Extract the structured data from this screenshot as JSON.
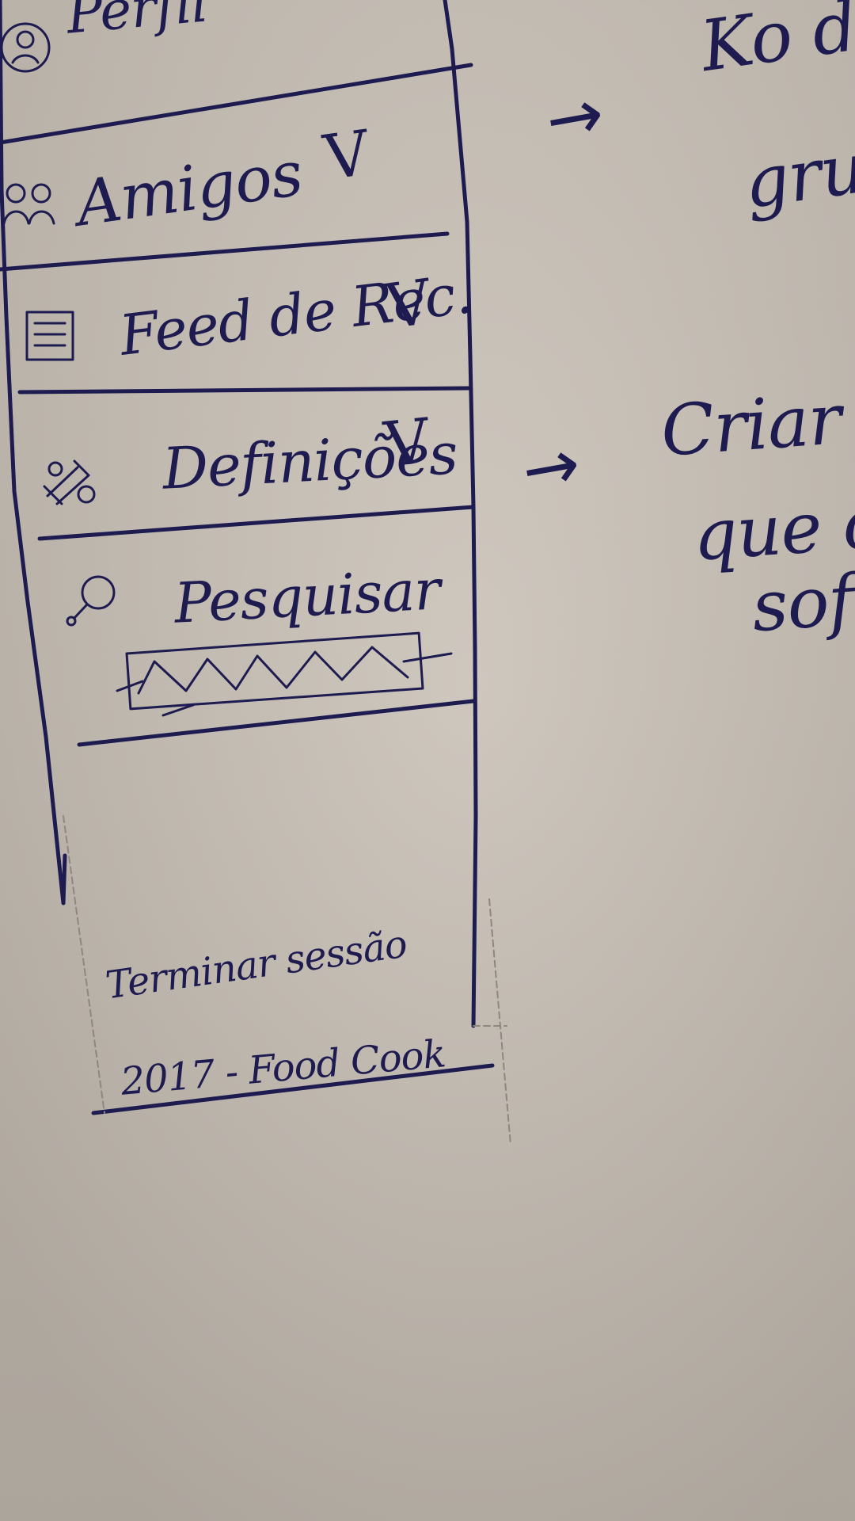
{
  "menu": {
    "items": [
      {
        "icon": "profile-icon",
        "label": "Perfil",
        "check": ""
      },
      {
        "icon": "friends-icon",
        "label": "Amigos",
        "check": "V"
      },
      {
        "icon": "feed-icon",
        "label": "Feed de Rec.",
        "check": "V"
      },
      {
        "icon": "settings-icon",
        "label": "Definições",
        "check": "V"
      },
      {
        "icon": "search-icon",
        "label": "Pesquisar",
        "check": ""
      }
    ],
    "footer": {
      "line1": "Terminar sessão",
      "line2": "2017 - Food Cook"
    }
  },
  "notes": {
    "note1": {
      "line1": "Ko d",
      "line2": "gru"
    },
    "note2": {
      "line1": "Criar",
      "line2": "que os",
      "line3": "sof"
    }
  },
  "arrows": {
    "arrow1": "→",
    "arrow2": "→"
  },
  "colors": {
    "paper": "#c9c1b7",
    "ink": "#1d1b4f",
    "pencil": "#8d877f"
  }
}
